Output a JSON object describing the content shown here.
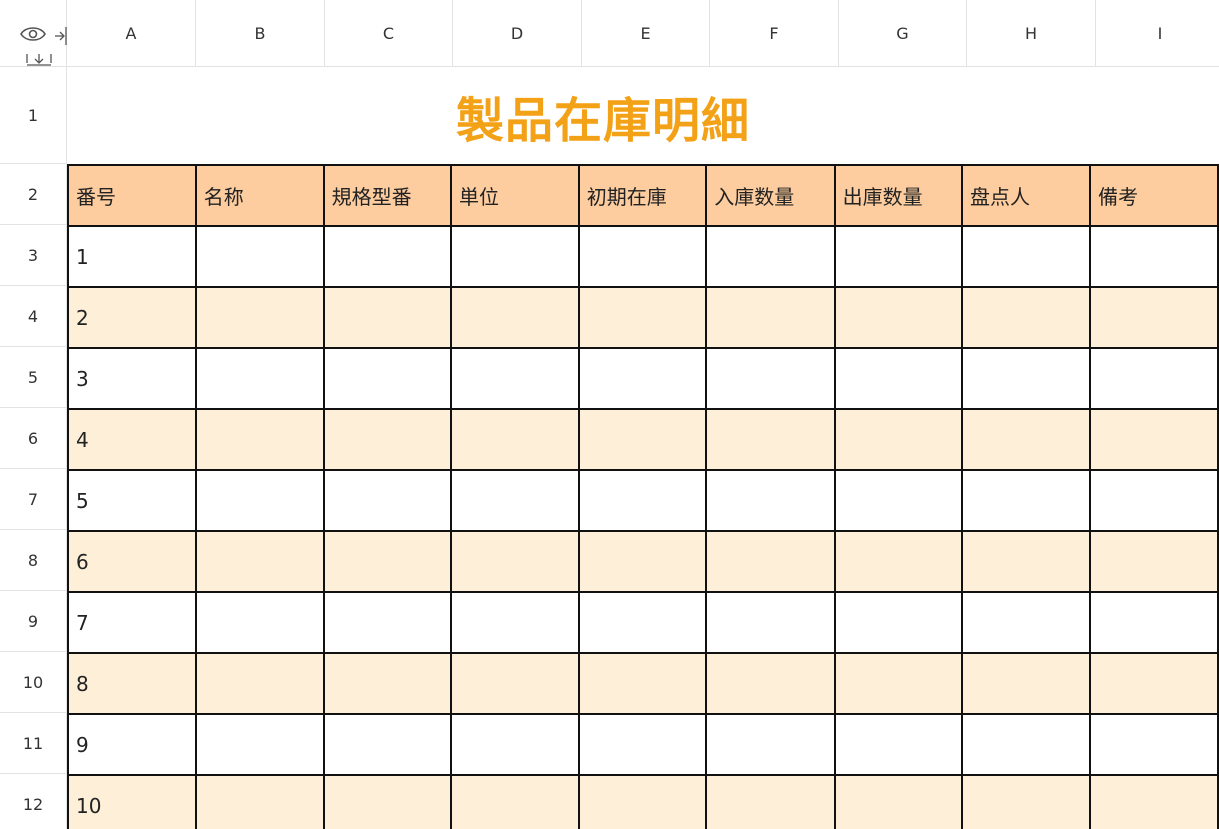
{
  "column_headers": [
    "A",
    "B",
    "C",
    "D",
    "E",
    "F",
    "G",
    "H",
    "I"
  ],
  "row_headers": [
    "1",
    "2",
    "3",
    "4",
    "5",
    "6",
    "7",
    "8",
    "9",
    "10",
    "11",
    "12"
  ],
  "title": "製品在庫明細",
  "table": {
    "headers": [
      "番号",
      "名称",
      "規格型番",
      "単位",
      "初期在庫",
      "入庫数量",
      "出庫数量",
      "盘点人",
      "備考"
    ],
    "rows": [
      "1",
      "2",
      "3",
      "4",
      "5",
      "6",
      "7",
      "8",
      "9",
      "10"
    ]
  },
  "colors": {
    "title": "#f3a116",
    "header_fill": "#fdcc9f",
    "band_fill": "#fef0d8",
    "border": "#111111"
  }
}
